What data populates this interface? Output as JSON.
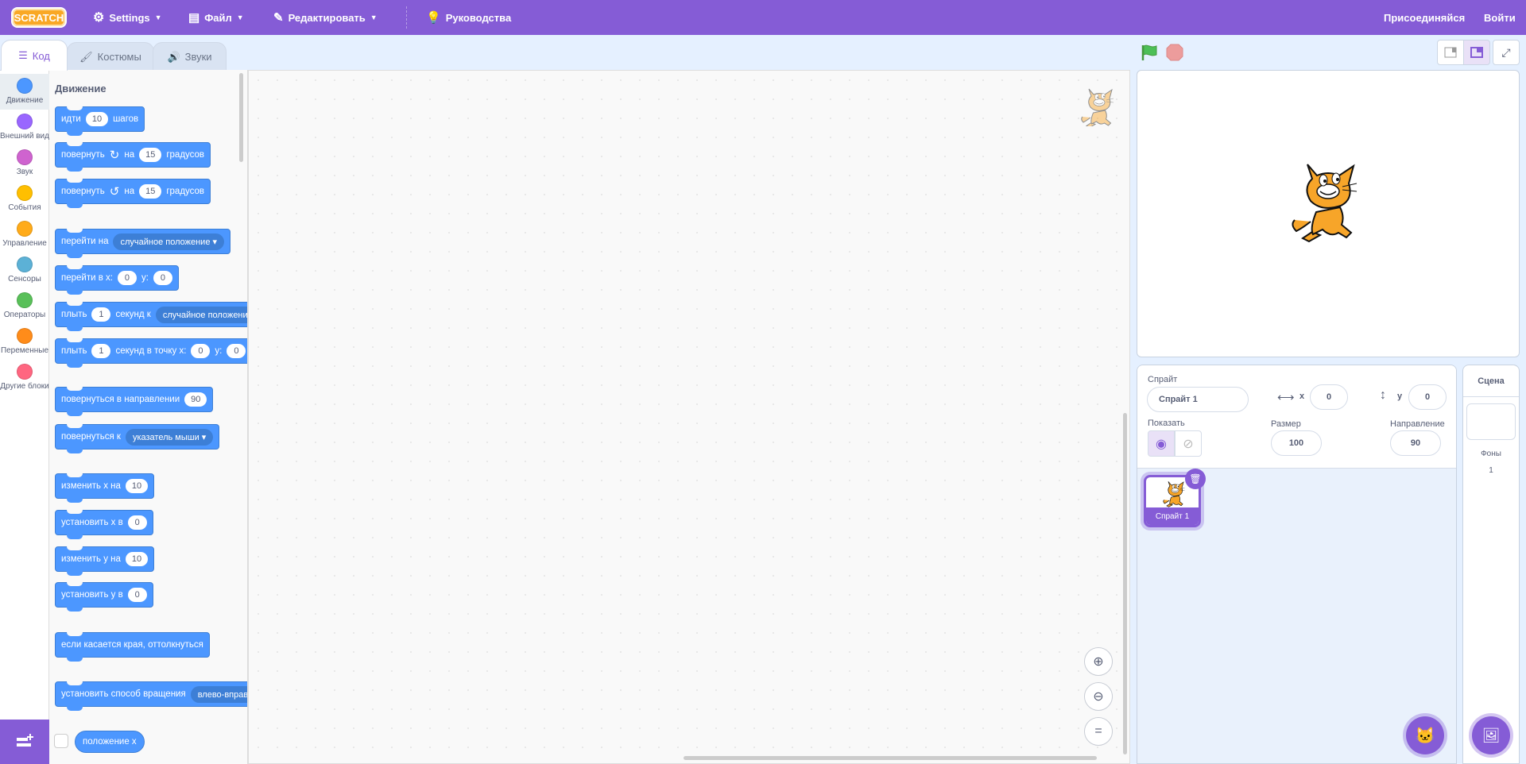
{
  "menubar": {
    "logo": "SCRATCH",
    "settings": "Settings",
    "file": "Файл",
    "edit": "Редактировать",
    "tutorials": "Руководства",
    "join": "Присоединяйся",
    "signin": "Войти"
  },
  "tabs": [
    {
      "label": "Код"
    },
    {
      "label": "Костюмы"
    },
    {
      "label": "Звуки"
    }
  ],
  "categories": [
    {
      "label": "Движение",
      "color": "#4c97ff"
    },
    {
      "label": "Внешний вид",
      "color": "#9966ff"
    },
    {
      "label": "Звук",
      "color": "#cf63cf"
    },
    {
      "label": "События",
      "color": "#ffbf00"
    },
    {
      "label": "Управление",
      "color": "#ffab19"
    },
    {
      "label": "Сенсоры",
      "color": "#5cb1d6"
    },
    {
      "label": "Операторы",
      "color": "#59c059"
    },
    {
      "label": "Переменные",
      "color": "#ff8c1a"
    },
    {
      "label": "Другие блоки",
      "color": "#ff6680"
    }
  ],
  "flyout": {
    "title": "Движение",
    "blocks": [
      [
        {
          "t": "идти"
        },
        {
          "v": "10"
        },
        {
          "t": "шагов"
        }
      ],
      [
        {
          "t": "повернуть"
        },
        {
          "i": "↻"
        },
        {
          "t": "на"
        },
        {
          "v": "15"
        },
        {
          "t": "градусов"
        }
      ],
      [
        {
          "t": "повернуть"
        },
        {
          "i": "↺"
        },
        {
          "t": "на"
        },
        {
          "v": "15"
        },
        {
          "t": "градусов"
        }
      ],
      [
        {
          "t": "перейти на"
        },
        {
          "d": "случайное положение"
        }
      ],
      [
        {
          "t": "перейти в x:"
        },
        {
          "v": "0"
        },
        {
          "t": "y:"
        },
        {
          "v": "0"
        }
      ],
      [
        {
          "t": "плыть"
        },
        {
          "v": "1"
        },
        {
          "t": "секунд к"
        },
        {
          "d": "случайное положение"
        }
      ],
      [
        {
          "t": "плыть"
        },
        {
          "v": "1"
        },
        {
          "t": "секунд в точку x:"
        },
        {
          "v": "0"
        },
        {
          "t": "y:"
        },
        {
          "v": "0"
        }
      ],
      [
        {
          "t": "повернуться в направлении"
        },
        {
          "v": "90"
        }
      ],
      [
        {
          "t": "повернуться к"
        },
        {
          "d": "указатель мыши"
        }
      ],
      [
        {
          "t": "изменить x на"
        },
        {
          "v": "10"
        }
      ],
      [
        {
          "t": "установить x в"
        },
        {
          "v": "0"
        }
      ],
      [
        {
          "t": "изменить y на"
        },
        {
          "v": "10"
        }
      ],
      [
        {
          "t": "установить y в"
        },
        {
          "v": "0"
        }
      ],
      [
        {
          "t": "если касается края, оттолкнуться"
        }
      ],
      [
        {
          "t": "установить способ вращения"
        },
        {
          "d": "влево-вправо"
        }
      ]
    ],
    "reporter": "положение x"
  },
  "sprite": {
    "label_sprite": "Спрайт",
    "name": "Спрайт 1",
    "x_label": "x",
    "x": "0",
    "y_label": "y",
    "y": "0",
    "show_label": "Показать",
    "size_label": "Размер",
    "size": "100",
    "dir_label": "Направление",
    "direction": "90",
    "thumb_name": "Спрайт 1"
  },
  "stage_selector": {
    "title": "Сцена",
    "backdrops_label": "Фоны",
    "backdrops_count": "1"
  },
  "colors": {
    "accent": "#855cd6",
    "motion": "#4c97ff"
  }
}
